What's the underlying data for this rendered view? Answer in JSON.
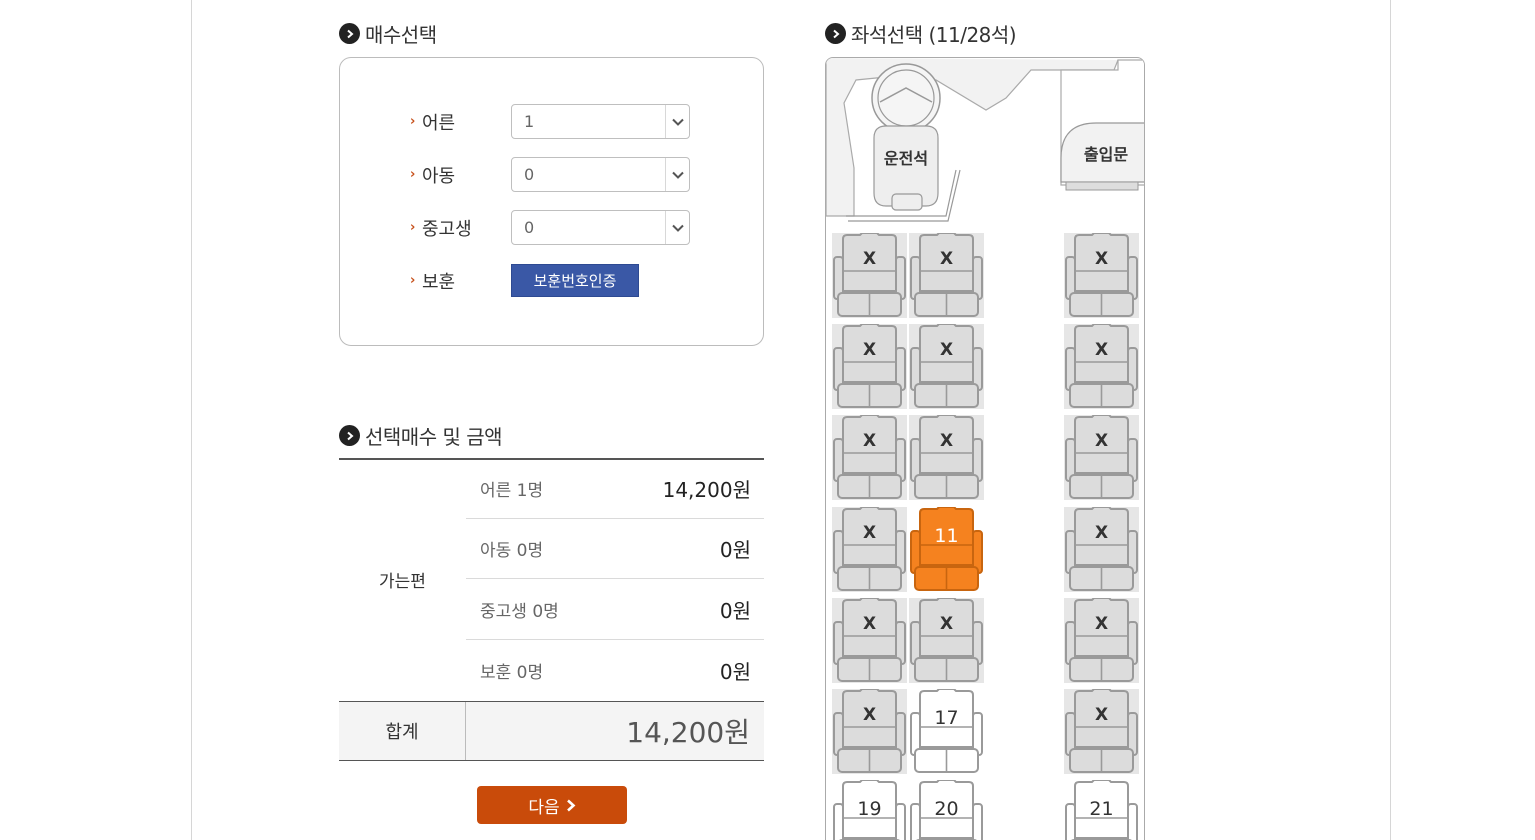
{
  "ticket_section": {
    "title": "매수선택",
    "rows": [
      {
        "label": "어른",
        "value": "1"
      },
      {
        "label": "아동",
        "value": "0"
      },
      {
        "label": "중고생",
        "value": "0"
      }
    ],
    "veteran": {
      "label": "보훈",
      "button": "보훈번호인증"
    }
  },
  "price_section": {
    "title": "선택매수 및 금액",
    "route": "가는편",
    "rows": [
      {
        "label": "어른 1명",
        "value": "14,200원"
      },
      {
        "label": "아동 0명",
        "value": "0원"
      },
      {
        "label": "중고생 0명",
        "value": "0원"
      },
      {
        "label": "보훈 0명",
        "value": "0원"
      }
    ],
    "total_label": "합계",
    "total_value": "14,200원"
  },
  "next_button": "다음",
  "seat_section": {
    "title": "좌석선택 (11/28석)",
    "driver_label": "운전석",
    "door_label": "출입문",
    "sold_mark": "X",
    "seats": [
      {
        "label": "X",
        "status": "sold"
      },
      {
        "label": "X",
        "status": "sold"
      },
      {
        "label": "X",
        "status": "sold"
      },
      {
        "label": "X",
        "status": "sold"
      },
      {
        "label": "X",
        "status": "sold"
      },
      {
        "label": "X",
        "status": "sold"
      },
      {
        "label": "X",
        "status": "sold"
      },
      {
        "label": "X",
        "status": "sold"
      },
      {
        "label": "X",
        "status": "sold"
      },
      {
        "label": "X",
        "status": "sold"
      },
      {
        "label": "11",
        "status": "selected"
      },
      {
        "label": "X",
        "status": "sold"
      },
      {
        "label": "X",
        "status": "sold"
      },
      {
        "label": "X",
        "status": "sold"
      },
      {
        "label": "X",
        "status": "sold"
      },
      {
        "label": "X",
        "status": "sold"
      },
      {
        "label": "17",
        "status": "available"
      },
      {
        "label": "X",
        "status": "sold"
      },
      {
        "label": "19",
        "status": "available"
      },
      {
        "label": "20",
        "status": "available"
      },
      {
        "label": "21",
        "status": "available"
      }
    ]
  },
  "colors": {
    "accent": "#c94b0a",
    "selected_seat": "#f5821f",
    "verify": "#3a58a6",
    "sold_seat": "#dcdcdc"
  }
}
